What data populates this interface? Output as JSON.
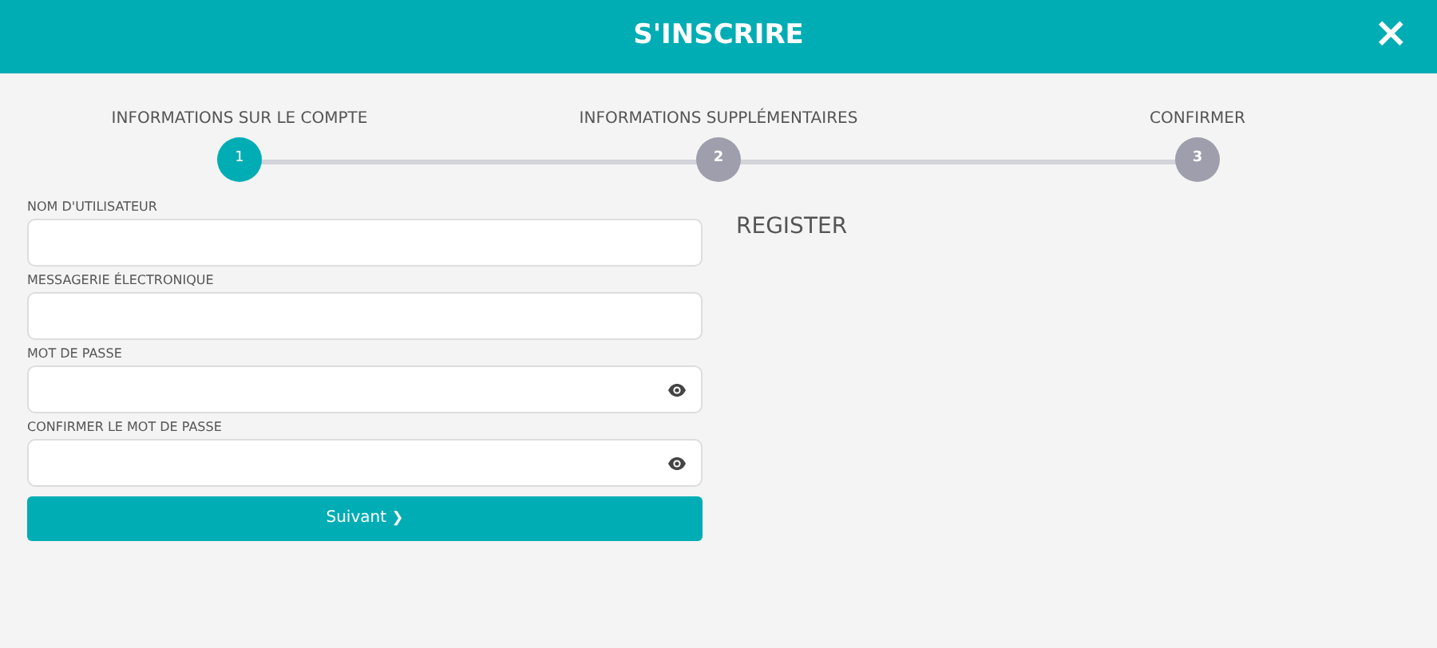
{
  "dialog": {
    "title": "S'INSCRIRE",
    "close": "×"
  },
  "steps": [
    {
      "label": "INFORMATIONS SUR LE COMPTE",
      "number": "1",
      "selected": true
    },
    {
      "label": "INFORMATIONS SUPPLÉMENTAIRES",
      "number": "2",
      "selected": false
    },
    {
      "label": "CONFIRMER",
      "number": "3",
      "selected": false
    }
  ],
  "fields": [
    {
      "label": "NOM D'UTILISATEUR",
      "kind": "text"
    },
    {
      "label": "MESSAGERIE ÉLECTRONIQUE",
      "kind": "text"
    },
    {
      "label": "MOT DE PASSE",
      "kind": "password"
    },
    {
      "label": "CONFIRMER LE MOT DE PASSE",
      "kind": "password"
    }
  ],
  "next_button": {
    "label": "Suivant",
    "icon": "❯"
  },
  "side_heading": "REGISTER"
}
